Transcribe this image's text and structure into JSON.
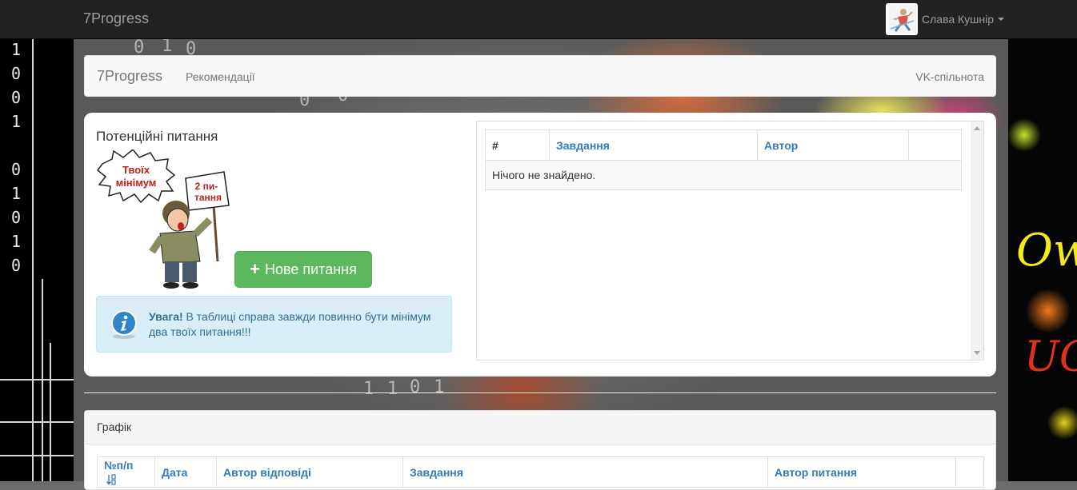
{
  "app": {
    "brand": "7Progress",
    "user_name": "Слава Кушнір"
  },
  "subnav": {
    "brand": "7Progress",
    "links": [
      "Рекомендації"
    ],
    "right_link": "VK-спільнота"
  },
  "questions": {
    "title": "Потенційні питання",
    "cartoon": {
      "speech": [
        "Твоїх",
        "мінімум"
      ],
      "sign": [
        "2 пи-",
        "тання"
      ]
    },
    "new_button": "Нове питання",
    "alert": {
      "strong": "Увага!",
      "text": " В таблиці справа завжди повинно бути мінімум два твоїх питання!!!"
    }
  },
  "questions_table": {
    "columns": [
      "#",
      "Завдання",
      "Автор",
      ""
    ],
    "empty_text": "Нічого не знайдено."
  },
  "graph": {
    "title": "Графік",
    "columns": [
      "№п/п",
      "Дата",
      "Автор відповіді",
      "Завдання",
      "Автор питання",
      ""
    ]
  },
  "background": {
    "left_digits": [
      "1",
      "0",
      "0",
      "1",
      "0",
      "1",
      "0",
      "1",
      "0"
    ],
    "center_digits": [
      "0",
      "1",
      "0",
      "1",
      "0",
      "0",
      "1",
      "1",
      "0",
      "1"
    ],
    "right_scribbles": [
      "Ow",
      "UG"
    ]
  },
  "colors": {
    "navbar_bg": "#222222",
    "success": "#5cb85c",
    "link": "#337ab7",
    "info_bg": "#d9edf7",
    "info_text": "#31708f"
  }
}
